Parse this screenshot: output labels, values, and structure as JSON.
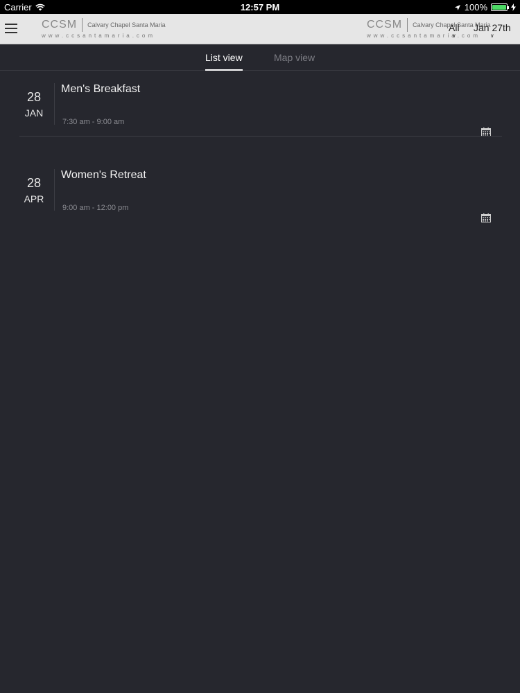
{
  "status_bar": {
    "carrier": "Carrier",
    "time": "12:57 PM",
    "battery": "100%",
    "battery_level": 1.0
  },
  "header": {
    "logo_mark": "CCSM",
    "logo_name": "Calvary Chapel Santa Maria",
    "logo_url": "www.ccsantamaria.com",
    "filter_all": "All",
    "filter_date": "Jan 27th"
  },
  "tabs": {
    "list": "List view",
    "map": "Map view"
  },
  "events": [
    {
      "day": "28",
      "month": "JAN",
      "title": "Men's Breakfast",
      "time": "7:30 am - 9:00 am"
    },
    {
      "day": "28",
      "month": "APR",
      "title": "Women's Retreat",
      "time": "9:00 am - 12:00 pm"
    }
  ],
  "icons": {
    "menu": "hamburger-icon",
    "calendar": "calendar-icon",
    "wifi": "wifi-icon",
    "location": "location-arrow-icon",
    "charging": "bolt-icon"
  },
  "colors": {
    "background": "#26272e",
    "header": "#e6e6e6",
    "battery_fill": "#4cd964"
  }
}
